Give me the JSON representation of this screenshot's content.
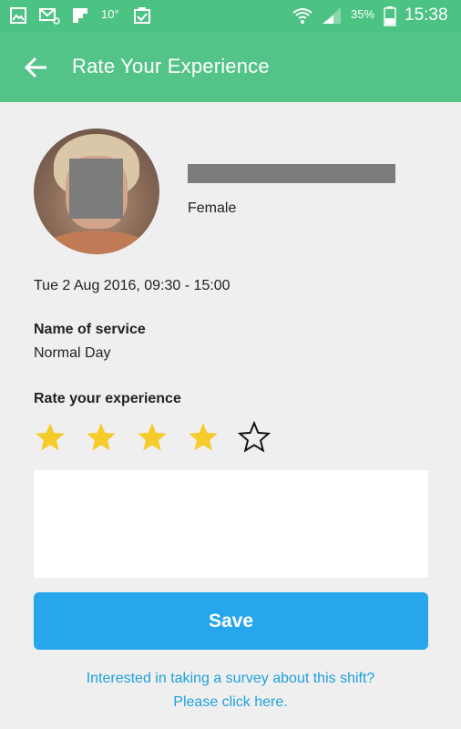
{
  "status_bar": {
    "temperature": "10°",
    "battery_percent": "35%",
    "time": "15:38",
    "icons": [
      "image-icon",
      "email-icon",
      "flipboard-icon",
      "clipboard-check-icon",
      "wifi-icon",
      "signal-icon",
      "battery-icon"
    ]
  },
  "app_bar": {
    "title": "Rate Your Experience",
    "back_icon": "arrow-left-icon"
  },
  "colors": {
    "status_bar": "#4cc283",
    "app_bar": "#54c388",
    "star_filled": "#f5cc2a",
    "save_button": "#27a6ec",
    "link": "#1fa0dc",
    "background": "#efefef"
  },
  "profile": {
    "gender": "Female"
  },
  "shift": {
    "datetime": "Tue 2 Aug 2016, 09:30 - 15:00"
  },
  "service": {
    "label": "Name of service",
    "value": "Normal Day"
  },
  "rating": {
    "label": "Rate your experience",
    "value": 4,
    "max": 5
  },
  "comment": {
    "value": ""
  },
  "actions": {
    "save_label": "Save"
  },
  "survey": {
    "line1": "Interested in taking a survey about this shift?",
    "line2": "Please click here."
  }
}
